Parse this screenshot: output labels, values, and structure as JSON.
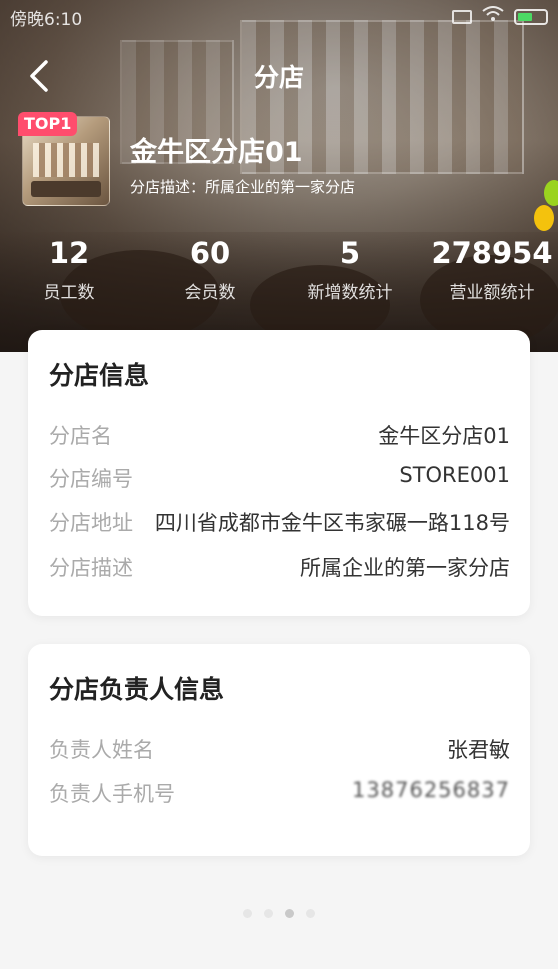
{
  "status_bar": {
    "time": "傍晚6:10",
    "icons": [
      "sim-icon",
      "wifi-icon",
      "battery-icon"
    ]
  },
  "nav": {
    "title": "分店",
    "back_icon": "chevron-left-icon"
  },
  "store": {
    "badge": "TOP1",
    "name": "金牛区分店01",
    "description": "分店描述：所属企业的第一家分店"
  },
  "stats": [
    {
      "value": "12",
      "label": "员工数"
    },
    {
      "value": "60",
      "label": "会员数"
    },
    {
      "value": "5",
      "label": "新增数统计"
    },
    {
      "value": "278954",
      "label": "营业额统计"
    }
  ],
  "branch_info": {
    "title": "分店信息",
    "rows": [
      {
        "label": "分店名",
        "value": "金牛区分店01"
      },
      {
        "label": "分店编号",
        "value": "STORE001"
      },
      {
        "label": "分店地址",
        "value": "四川省成都市金牛区韦家碾一路118号"
      },
      {
        "label": "分店描述",
        "value": "所属企业的第一家分店"
      }
    ]
  },
  "manager_info": {
    "title": "分店负责人信息",
    "rows": [
      {
        "label": "负责人姓名",
        "value": "张君敏"
      },
      {
        "label": "负责人手机号",
        "value": "13876256837"
      }
    ]
  },
  "pagination": {
    "count": 4,
    "active_index": 2
  },
  "colors": {
    "badge": "#ff4d6d",
    "card_bg": "#ffffff",
    "page_bg": "#f5f5f5",
    "label_gray": "#aaaaaa"
  }
}
